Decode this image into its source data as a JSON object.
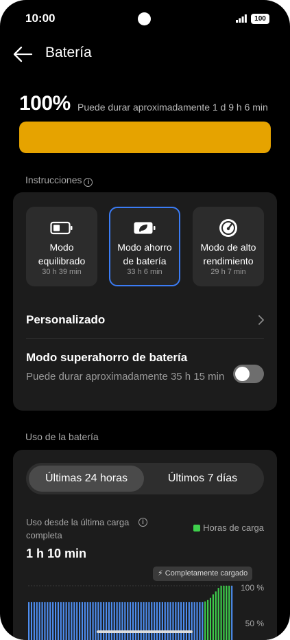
{
  "status_bar": {
    "time": "10:00",
    "battery_level": "100",
    "icons": [
      "camera-cutout",
      "signal-icon",
      "battery-icon"
    ]
  },
  "header": {
    "back_icon": "arrow-left-icon",
    "title": "Batería"
  },
  "summary": {
    "percent": "100%",
    "estimate": "Puede durar aproximadamente 1 d 9 h 6 min",
    "level_fraction": 1.0,
    "level_color": "#e6a300"
  },
  "instructions": {
    "label": "Instrucciones",
    "info_icon": "info-icon"
  },
  "modes": [
    {
      "label": "Modo equilibrado",
      "time": "30 h 39 min",
      "icon": "battery-half-icon",
      "selected": false
    },
    {
      "label": "Modo ahorro de batería",
      "time": "33 h 6 min",
      "icon": "battery-leaf-icon",
      "selected": true
    },
    {
      "label": "Modo de alto rendimiento",
      "time": "29 h 7 min",
      "icon": "speedometer-icon",
      "selected": false
    }
  ],
  "custom": {
    "label": "Personalizado",
    "icon": "chevron-right-icon"
  },
  "super_saver": {
    "title": "Modo superahorro de batería",
    "desc": "Puede durar aproximadamente 35 h 15 min",
    "enabled": false
  },
  "usage_section": {
    "label": "Uso de la batería"
  },
  "range_tabs": [
    {
      "label": "Últimas 24 horas",
      "active": true
    },
    {
      "label": "Últimos 7 días",
      "active": false
    }
  ],
  "usage": {
    "caption": "Uso desde la última carga completa",
    "info_icon": "info-icon",
    "legend": "Horas de carga",
    "legend_color": "#3ecf4c",
    "value": "1 h 10 min",
    "tooltip": "Completamente cargado",
    "tooltip_icon": "lightning-icon"
  },
  "chart_data": {
    "type": "bar",
    "y_tick_labels": [
      "100 %",
      "50 %"
    ],
    "ylim": [
      0,
      100
    ],
    "series": [
      {
        "values": [
          77,
          77,
          77,
          77,
          77,
          77,
          77,
          77,
          77,
          77,
          77,
          77,
          77,
          77,
          77,
          77,
          77,
          77,
          77,
          77,
          77,
          77,
          77,
          77,
          77,
          77,
          77,
          77,
          77,
          77,
          77,
          77,
          77,
          77,
          77,
          77,
          77,
          77,
          77,
          77,
          77,
          77,
          77,
          77,
          77,
          77,
          77,
          77,
          77,
          77,
          77,
          77,
          77,
          77,
          77,
          77,
          77,
          77,
          77,
          77,
          77,
          77,
          77,
          77,
          77,
          77,
          78,
          80,
          83,
          88,
          92,
          97,
          100,
          100,
          100,
          100,
          100
        ]
      }
    ],
    "colors": {
      "discharge": "#4d8df0",
      "charge": "#3ecf4c"
    },
    "charging_range": [
      66,
      75
    ],
    "grid": true,
    "legend": "top-right"
  }
}
